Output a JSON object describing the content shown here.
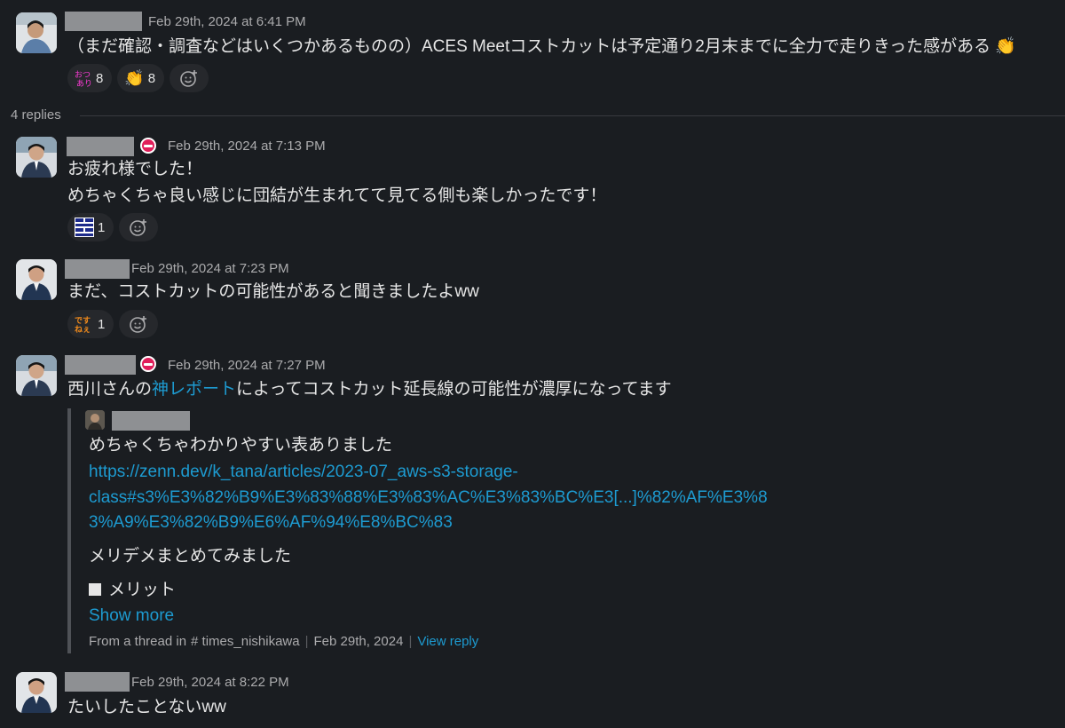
{
  "messages": [
    {
      "timestamp": "Feb 29th, 2024 at 6:41 PM",
      "text": "（まだ確認・調査などはいくつかあるものの）ACES Meetコストカットは予定通り2月末までに全力で走りきった感がある",
      "emoji": "👏",
      "reactions": [
        {
          "emoji": "custom-emoji-otsu",
          "count": "8"
        },
        {
          "emoji": "👏",
          "count": "8"
        }
      ]
    },
    {
      "replies_label": "4 replies"
    },
    {
      "timestamp": "Feb 29th, 2024 at 7:13 PM",
      "lines": [
        "お疲れ様でした！",
        "めちゃくちゃ良い感じに団結が生まれてて見てる側も楽しかったです！"
      ],
      "reactions": [
        {
          "emoji": "custom-emoji-blue",
          "count": "1"
        }
      ]
    },
    {
      "timestamp": "Feb 29th, 2024 at 7:23 PM",
      "text": "まだ、コストカットの可能性があると聞きましたよww",
      "reactions": [
        {
          "emoji": "custom-emoji-orange",
          "count": "1"
        }
      ]
    },
    {
      "timestamp": "Feb 29th, 2024 at 7:27 PM",
      "text_before": "西川さんの",
      "link": "神レポート",
      "text_after": "によってコストカット延長線の可能性が濃厚になってます",
      "quote": {
        "line1": "めちゃくちゃわかりやすい表ありました",
        "url1": "https://zenn.dev/k_tana/articles/2023-07_aws-s3-storage-",
        "url2": "class#s3%E3%82%B9%E3%83%88%E3%83%AC%E3%83%BC%E3[...]%82%AF%E3%8",
        "url3": "3%A9%E3%82%B9%E6%AF%94%E8%BC%83",
        "line2": "メリデメまとめてみました",
        "line3": "メリット",
        "show_more": "Show more",
        "footer_prefix": "From a thread in",
        "channel": "# times_nishikawa",
        "date": "Feb 29th, 2024",
        "view_reply": "View reply"
      }
    },
    {
      "timestamp": "Feb 29th, 2024 at 8:22 PM",
      "text": "たいしたことないww"
    }
  ],
  "colors": {
    "background": "#1a1d21",
    "text": "#e6e6e6",
    "muted": "#ababad",
    "link": "#1d9bd1",
    "reaction_bg": "#26282c"
  }
}
